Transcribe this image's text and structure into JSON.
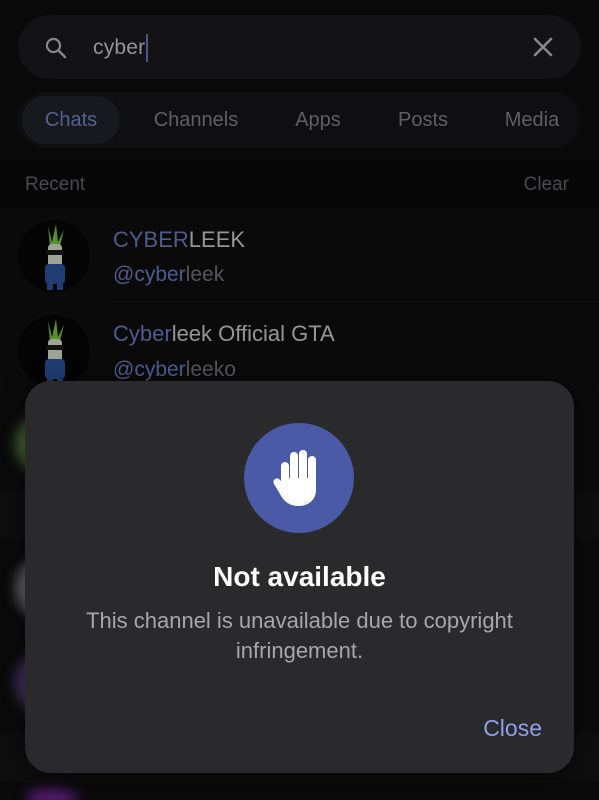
{
  "search": {
    "value": "cyber",
    "clear_icon": "close-icon",
    "search_icon": "search-icon"
  },
  "tabs": [
    {
      "label": "Chats",
      "active": true
    },
    {
      "label": "Channels",
      "active": false
    },
    {
      "label": "Apps",
      "active": false
    },
    {
      "label": "Posts",
      "active": false
    },
    {
      "label": "Media",
      "active": false
    }
  ],
  "recent": {
    "label": "Recent",
    "clear_label": "Clear"
  },
  "chats": [
    {
      "title_hl": "CYBER",
      "title_rest": "LEEK",
      "sub_hl": "@cyber",
      "sub_rest": "leek"
    },
    {
      "title_hl": "Cyber",
      "title_rest": "leek Official GTA",
      "sub_hl": "@cyber",
      "sub_rest": "leeko"
    }
  ],
  "dialog": {
    "icon": "hand-stop-icon",
    "title": "Not available",
    "text": "This channel is unavailable due to copyright infringement.",
    "close_label": "Close"
  },
  "colors": {
    "accent": "#7386d1",
    "dialog_icon_bg": "#4a5aa6",
    "close_button": "#8ea0e8"
  }
}
